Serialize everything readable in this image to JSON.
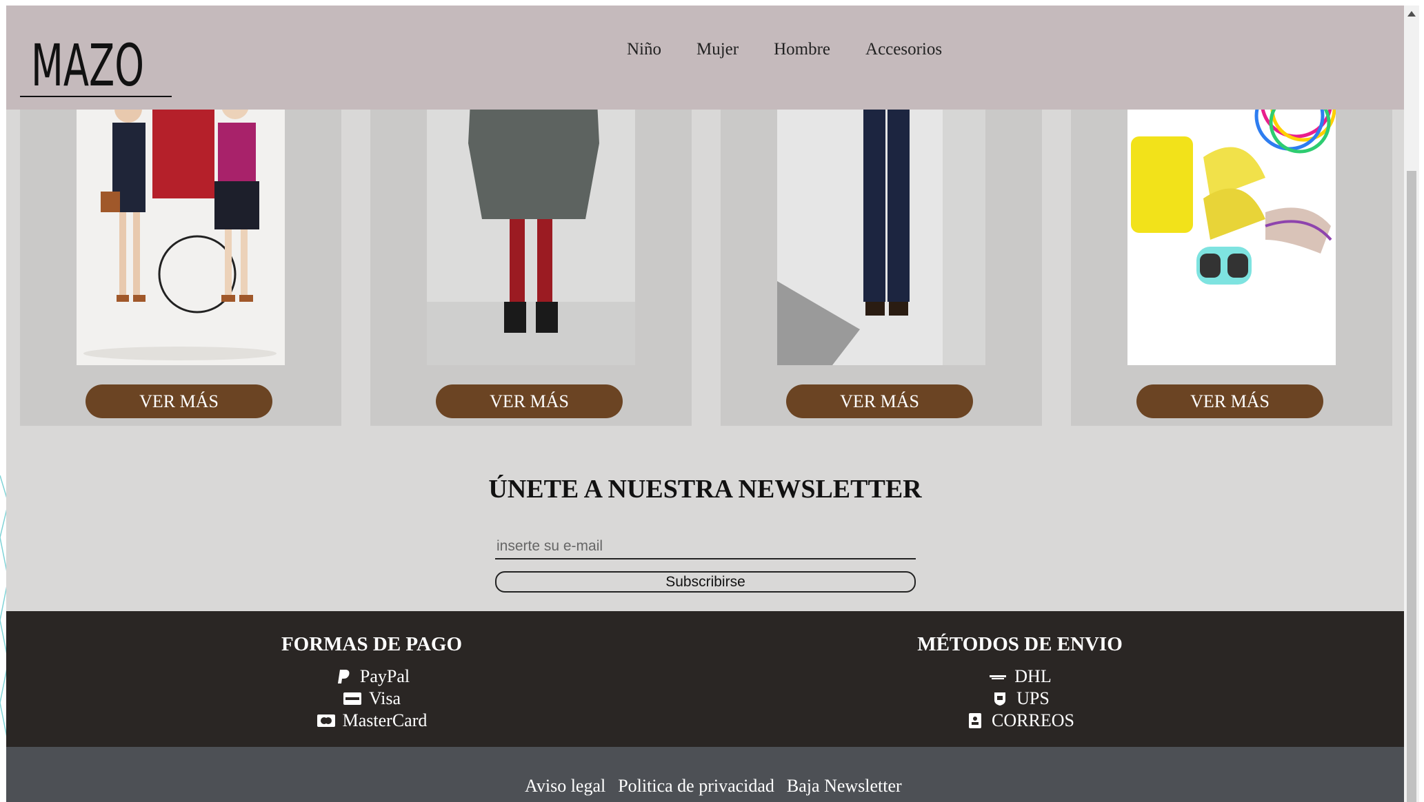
{
  "brand": {
    "logo_text": "MAZO"
  },
  "nav": {
    "items": [
      "Niño",
      "Mujer",
      "Hombre",
      "Accesorios"
    ]
  },
  "products": [
    {
      "category": "Niño",
      "button_label": "VER MÁS"
    },
    {
      "category": "Mujer",
      "button_label": "VER MÁS"
    },
    {
      "category": "Hombre",
      "button_label": "VER MÁS"
    },
    {
      "category": "Accesorios",
      "button_label": "VER MÁS"
    }
  ],
  "newsletter": {
    "title": "ÚNETE A NUESTRA NEWSLETTER",
    "email_placeholder": "inserte su e-mail",
    "subscribe_label": "Subscribirse"
  },
  "footer": {
    "payment": {
      "title": "FORMAS DE PAGO",
      "items": [
        {
          "label": "PayPal",
          "icon": "paypal-icon"
        },
        {
          "label": "Visa",
          "icon": "visa-icon"
        },
        {
          "label": "MasterCard",
          "icon": "mastercard-icon"
        }
      ]
    },
    "shipping": {
      "title": "MÉTODOS DE ENVIO",
      "items": [
        {
          "label": "DHL",
          "icon": "dhl-icon"
        },
        {
          "label": "UPS",
          "icon": "ups-icon"
        },
        {
          "label": "CORREOS",
          "icon": "correos-icon"
        }
      ]
    },
    "links": [
      "Aviso legal",
      "Politica de privacidad",
      "Baja Newsletter"
    ]
  },
  "colors": {
    "header_bg": "#c5babc",
    "button_brown": "#6b4423",
    "footer_dark": "#2a2624",
    "footer_grey": "#4d5055",
    "page_bg": "#d9d8d7"
  }
}
